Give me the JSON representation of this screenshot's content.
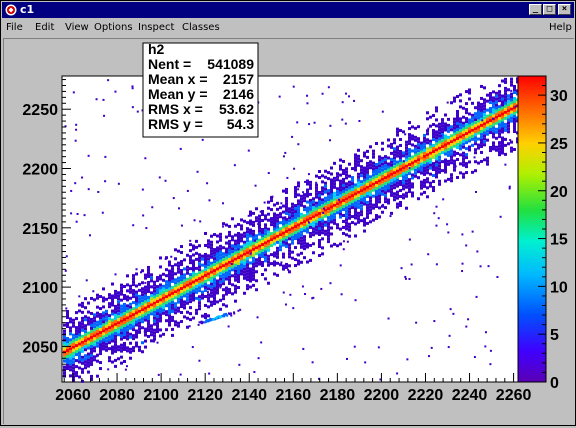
{
  "window": {
    "title": "c1",
    "controls": {
      "minimize": "_",
      "maximize": "□",
      "close": "×"
    }
  },
  "menu": {
    "items": [
      "File",
      "Edit",
      "View",
      "Options",
      "Inspect",
      "Classes"
    ],
    "help": "Help"
  },
  "stats_box": {
    "name": "h2",
    "lines": [
      {
        "label": "Nent = ",
        "value": "541089"
      },
      {
        "label": "Mean x = ",
        "value": "2157"
      },
      {
        "label": "Mean y = ",
        "value": "2146"
      },
      {
        "label": "RMS x = ",
        "value": "53.62"
      },
      {
        "label": "RMS y = ",
        "value": "54.3"
      }
    ]
  },
  "chart_data": {
    "type": "heatmap",
    "title": "",
    "xlabel": "",
    "ylabel": "",
    "xlim": [
      2055,
      2262
    ],
    "ylim": [
      2020,
      2278
    ],
    "x_ticks": [
      2060,
      2080,
      2100,
      2120,
      2140,
      2160,
      2180,
      2200,
      2220,
      2240,
      2260
    ],
    "y_ticks": [
      2050,
      2100,
      2150,
      2200,
      2250
    ],
    "z_range": [
      0,
      32
    ],
    "z_ticks": [
      0,
      5,
      10,
      15,
      20,
      25,
      30
    ],
    "bands": [
      {
        "x_start": 2055,
        "y_start": 2046,
        "x_end": 2262,
        "y_end": 2255,
        "core_count": 24,
        "halo_count": 6
      }
    ],
    "clusters": [
      {
        "x": 2125,
        "y": 2075,
        "x_spread": 5,
        "y_spread": 3,
        "peak_count": 8
      }
    ],
    "colors": [
      "#3c00c8",
      "#0066ff",
      "#00ccff",
      "#22e080",
      "#a8e020",
      "#ffd000",
      "#ff7000",
      "#ff0000"
    ]
  }
}
